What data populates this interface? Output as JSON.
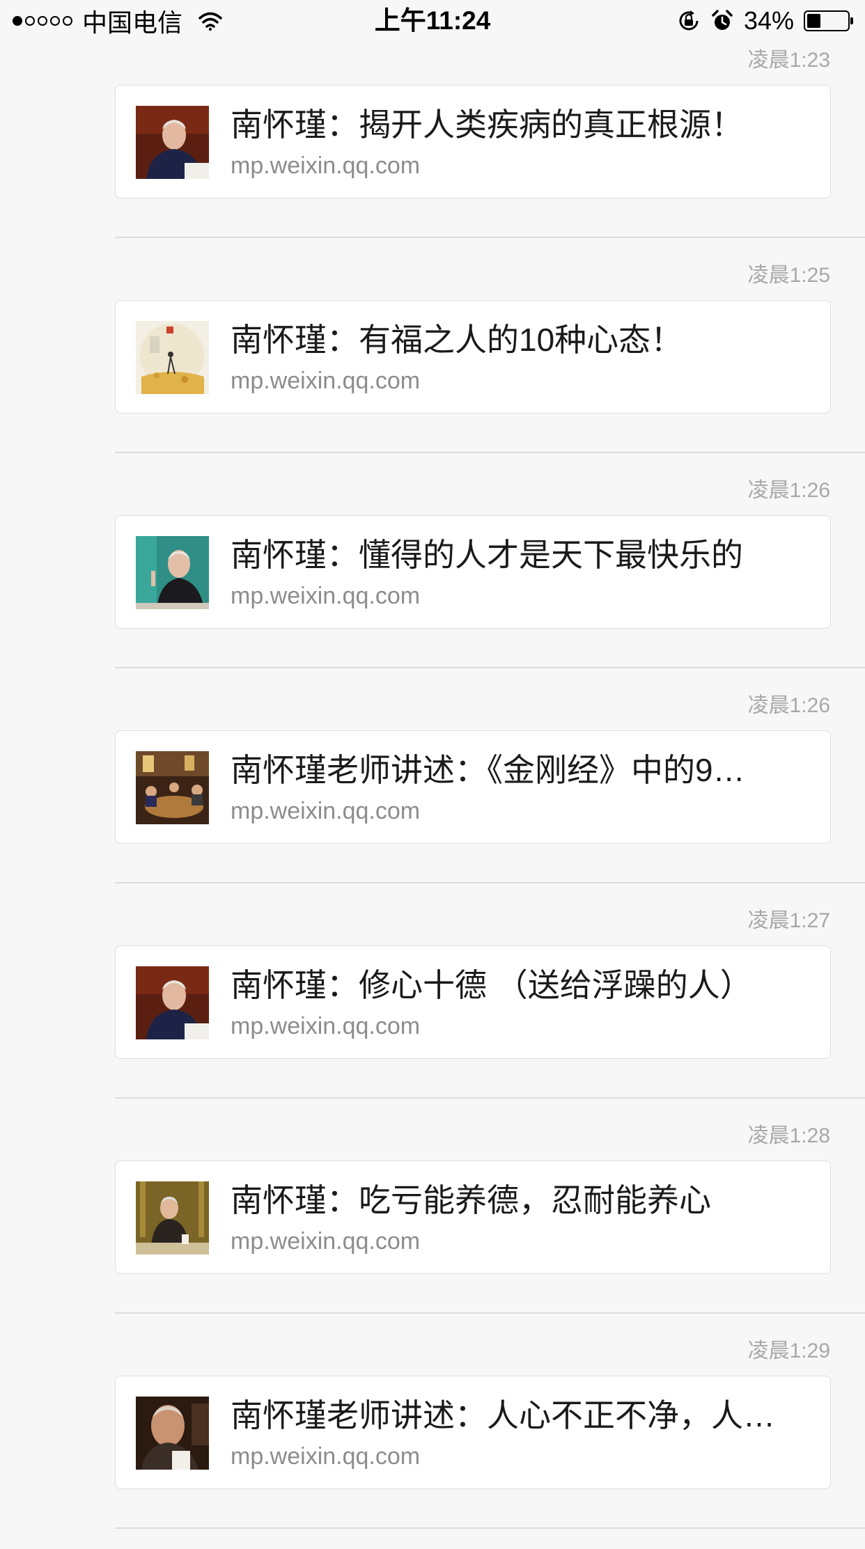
{
  "status_bar": {
    "carrier": "中国电信",
    "time": "上午11:24",
    "battery": "34%",
    "battery_level": 0.34,
    "signal_filled": 1,
    "signal_total": 5
  },
  "messages": [
    {
      "time": "凌晨1:23",
      "title": "南怀瑾：揭开人类疾病的真正根源！",
      "source": "mp.weixin.qq.com",
      "thumb": "portrait-dark"
    },
    {
      "time": "凌晨1:25",
      "title": "南怀瑾：有福之人的10种心态！",
      "source": "mp.weixin.qq.com",
      "thumb": "painting-light"
    },
    {
      "time": "凌晨1:26",
      "title": "南怀瑾：懂得的人才是天下最快乐的",
      "source": "mp.weixin.qq.com",
      "thumb": "portrait-teal"
    },
    {
      "time": "凌晨1:26",
      "title": "南怀瑾老师讲述：《金刚经》中的9…",
      "source": "mp.weixin.qq.com",
      "thumb": "room-warm"
    },
    {
      "time": "凌晨1:27",
      "title": "南怀瑾：修心十德 （送给浮躁的人）",
      "source": "mp.weixin.qq.com",
      "thumb": "portrait-dark"
    },
    {
      "time": "凌晨1:28",
      "title": "南怀瑾：吃亏能养德，忍耐能养心",
      "source": "mp.weixin.qq.com",
      "thumb": "seated-gold"
    },
    {
      "time": "凌晨1:29",
      "title": "南怀瑾老师讲述：人心不正不净，人…",
      "source": "mp.weixin.qq.com",
      "thumb": "closeup-brown"
    }
  ]
}
